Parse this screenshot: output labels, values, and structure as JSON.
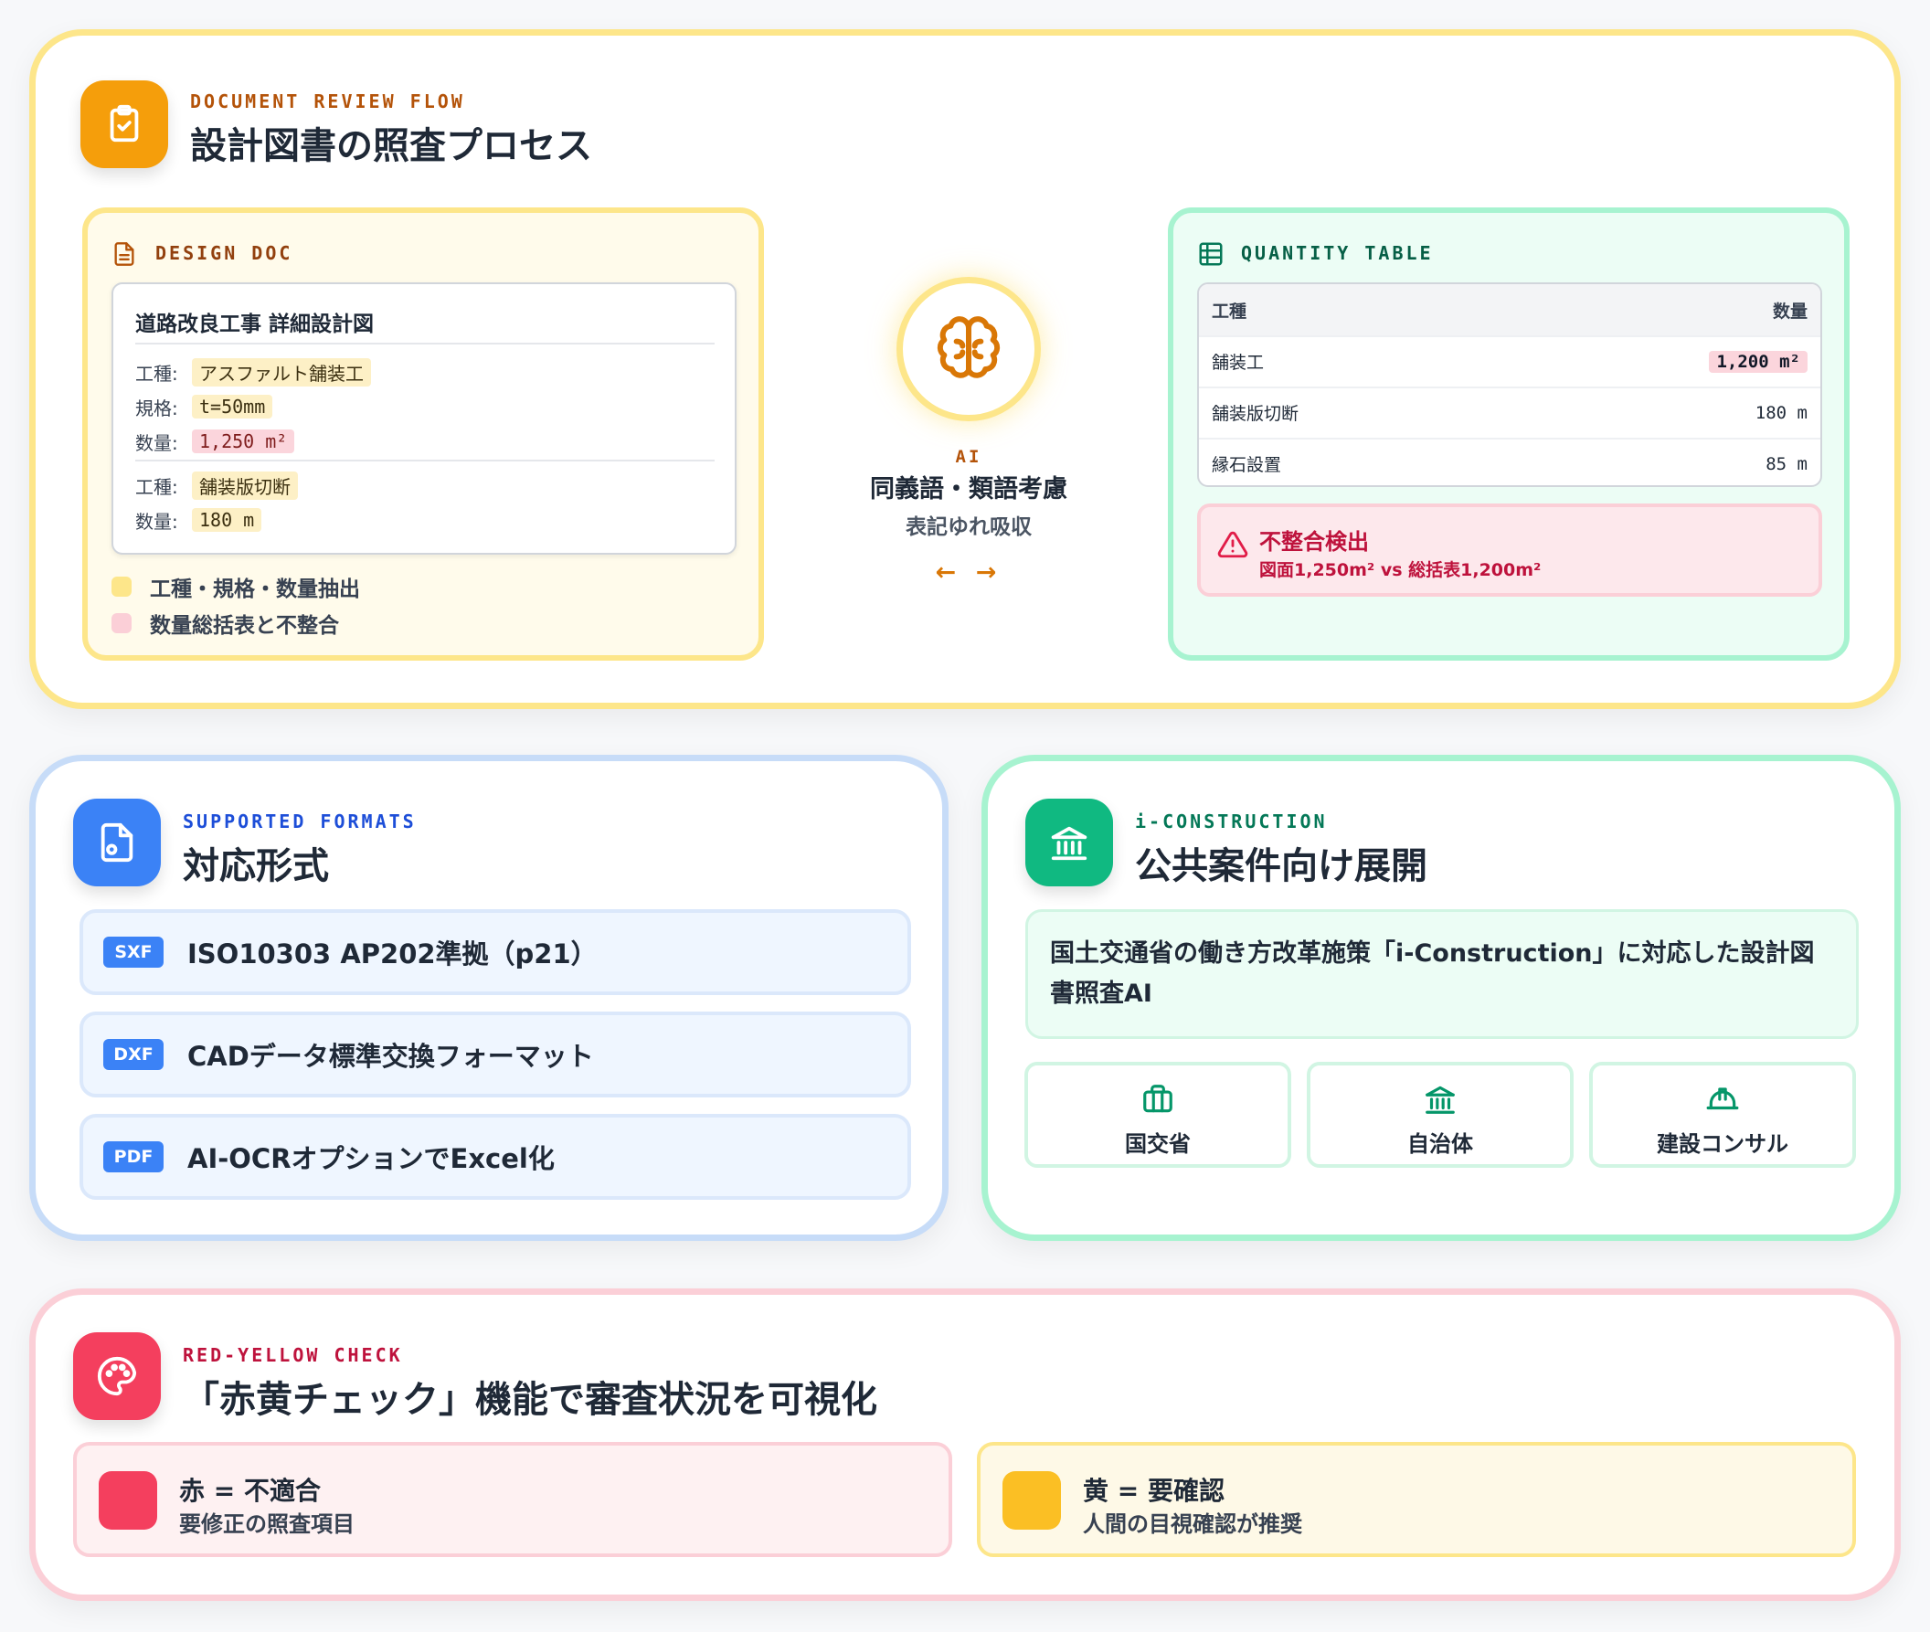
{
  "review": {
    "eyebrow": "DOCUMENT REVIEW FLOW",
    "title": "設計図書の照査プロセス",
    "design_doc": {
      "label": "DESIGN DOC",
      "doc_title": "道路改良工事 詳細設計図",
      "rows": [
        {
          "key": "工種:",
          "value": "アスファルト舗装工"
        },
        {
          "key": "規格:",
          "value": "t=50mm"
        },
        {
          "key": "数量:",
          "value": "1,250 m²"
        },
        {
          "key": "工種:",
          "value": "舗装版切断"
        },
        {
          "key": "数量:",
          "value": "180 m"
        }
      ],
      "legend": [
        "工種・規格・数量抽出",
        "数量総括表と不整合"
      ]
    },
    "ai": {
      "tag": "AI",
      "title": "同義語・類語考慮",
      "subtitle": "表記ゆれ吸収",
      "arrows": "← →"
    },
    "quantity_table": {
      "label": "QUANTITY TABLE",
      "headers": [
        "工種",
        "数量"
      ],
      "rows": [
        {
          "name": "舗装工",
          "qty": "1,200 m²"
        },
        {
          "name": "舗装版切断",
          "qty": "180 m"
        },
        {
          "name": "縁石設置",
          "qty": "85 m"
        }
      ],
      "alert_title": "不整合検出",
      "alert_detail": "図面1,250m² vs 総括表1,200m²"
    }
  },
  "formats": {
    "eyebrow": "SUPPORTED FORMATS",
    "title": "対応形式",
    "items": [
      {
        "tag": "SXF",
        "text": "ISO10303 AP202準拠（p21）"
      },
      {
        "tag": "DXF",
        "text": "CADデータ標準交換フォーマット"
      },
      {
        "tag": "PDF",
        "text": "AI-OCRオプションでExcel化"
      }
    ]
  },
  "iconstruction": {
    "eyebrow": "i-CONSTRUCTION",
    "title": "公共案件向け展開",
    "description": "国土交通省の働き方改革施策「i-Construction」に対応した設計図書照査AI",
    "targets": [
      {
        "label": "国交省",
        "icon": "briefcase-icon"
      },
      {
        "label": "自治体",
        "icon": "landmark-icon"
      },
      {
        "label": "建設コンサル",
        "icon": "hardhat-icon"
      }
    ]
  },
  "check": {
    "eyebrow": "RED-YELLOW CHECK",
    "title": "「赤黄チェック」機能で審査状況を可視化",
    "red": {
      "title": "赤 = 不適合",
      "subtitle": "要修正の照査項目",
      "color": "#f43f5e"
    },
    "yellow": {
      "title": "黄 = 要確認",
      "subtitle": "人間の目視確認が推奨",
      "color": "#fbbf24"
    }
  },
  "colors": {
    "orange": "#f59e0b",
    "blue": "#3b82f6",
    "green": "#10b981",
    "red": "#f43f5e"
  }
}
